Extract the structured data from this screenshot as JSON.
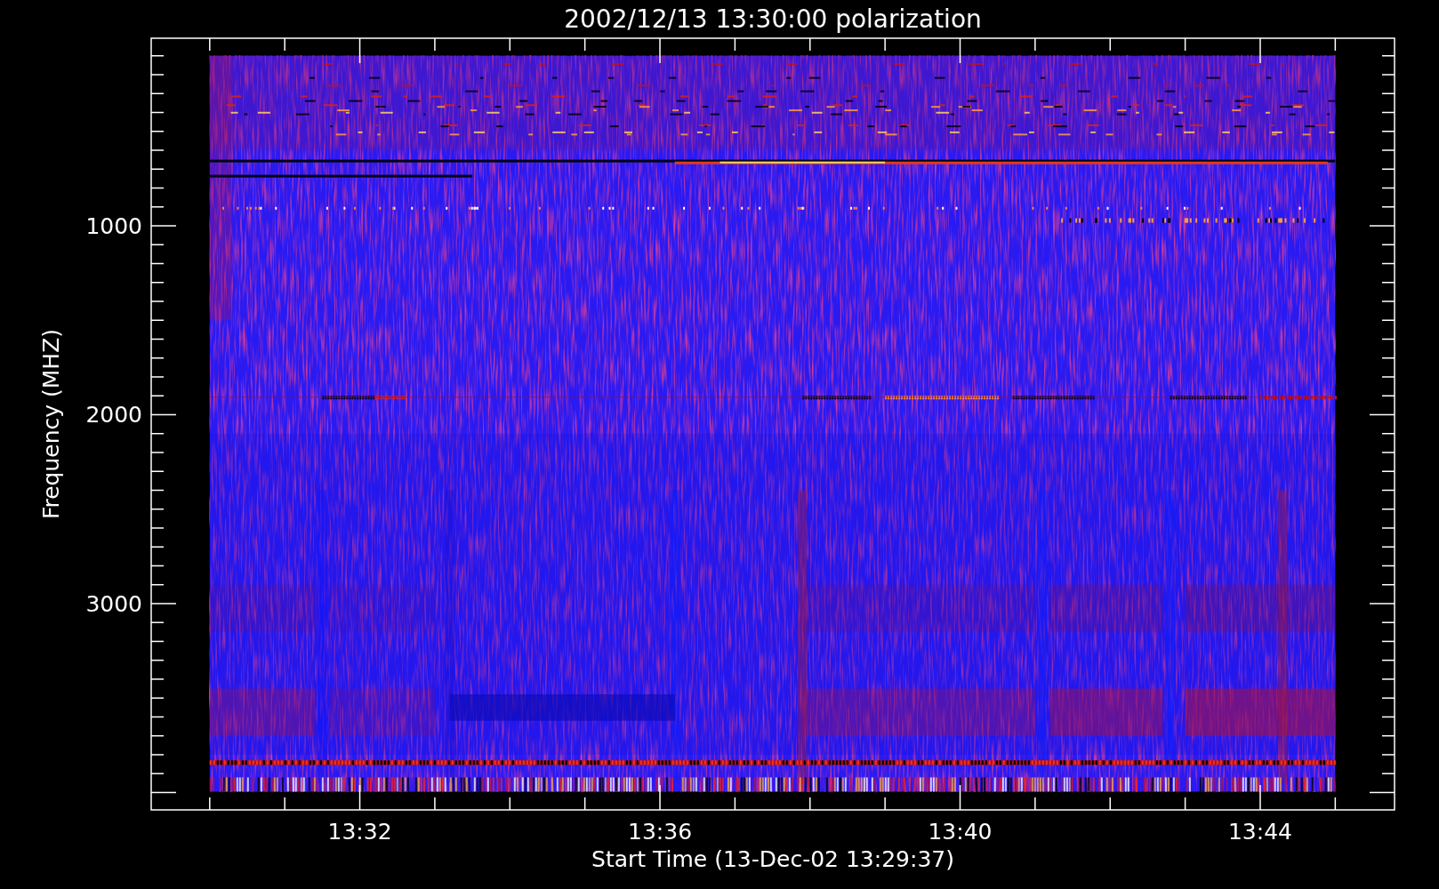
{
  "plot": {
    "title": "2002/12/13 13:30:00 polarization",
    "y_axis": {
      "label": "Frequency (MHZ)",
      "ticks": [
        "1000",
        "2000",
        "3000"
      ]
    },
    "x_axis": {
      "label": "Start Time (13-Dec-02 13:29:37)",
      "ticks": [
        "13:32",
        "13:36",
        "13:40",
        "13:44"
      ]
    }
  }
}
